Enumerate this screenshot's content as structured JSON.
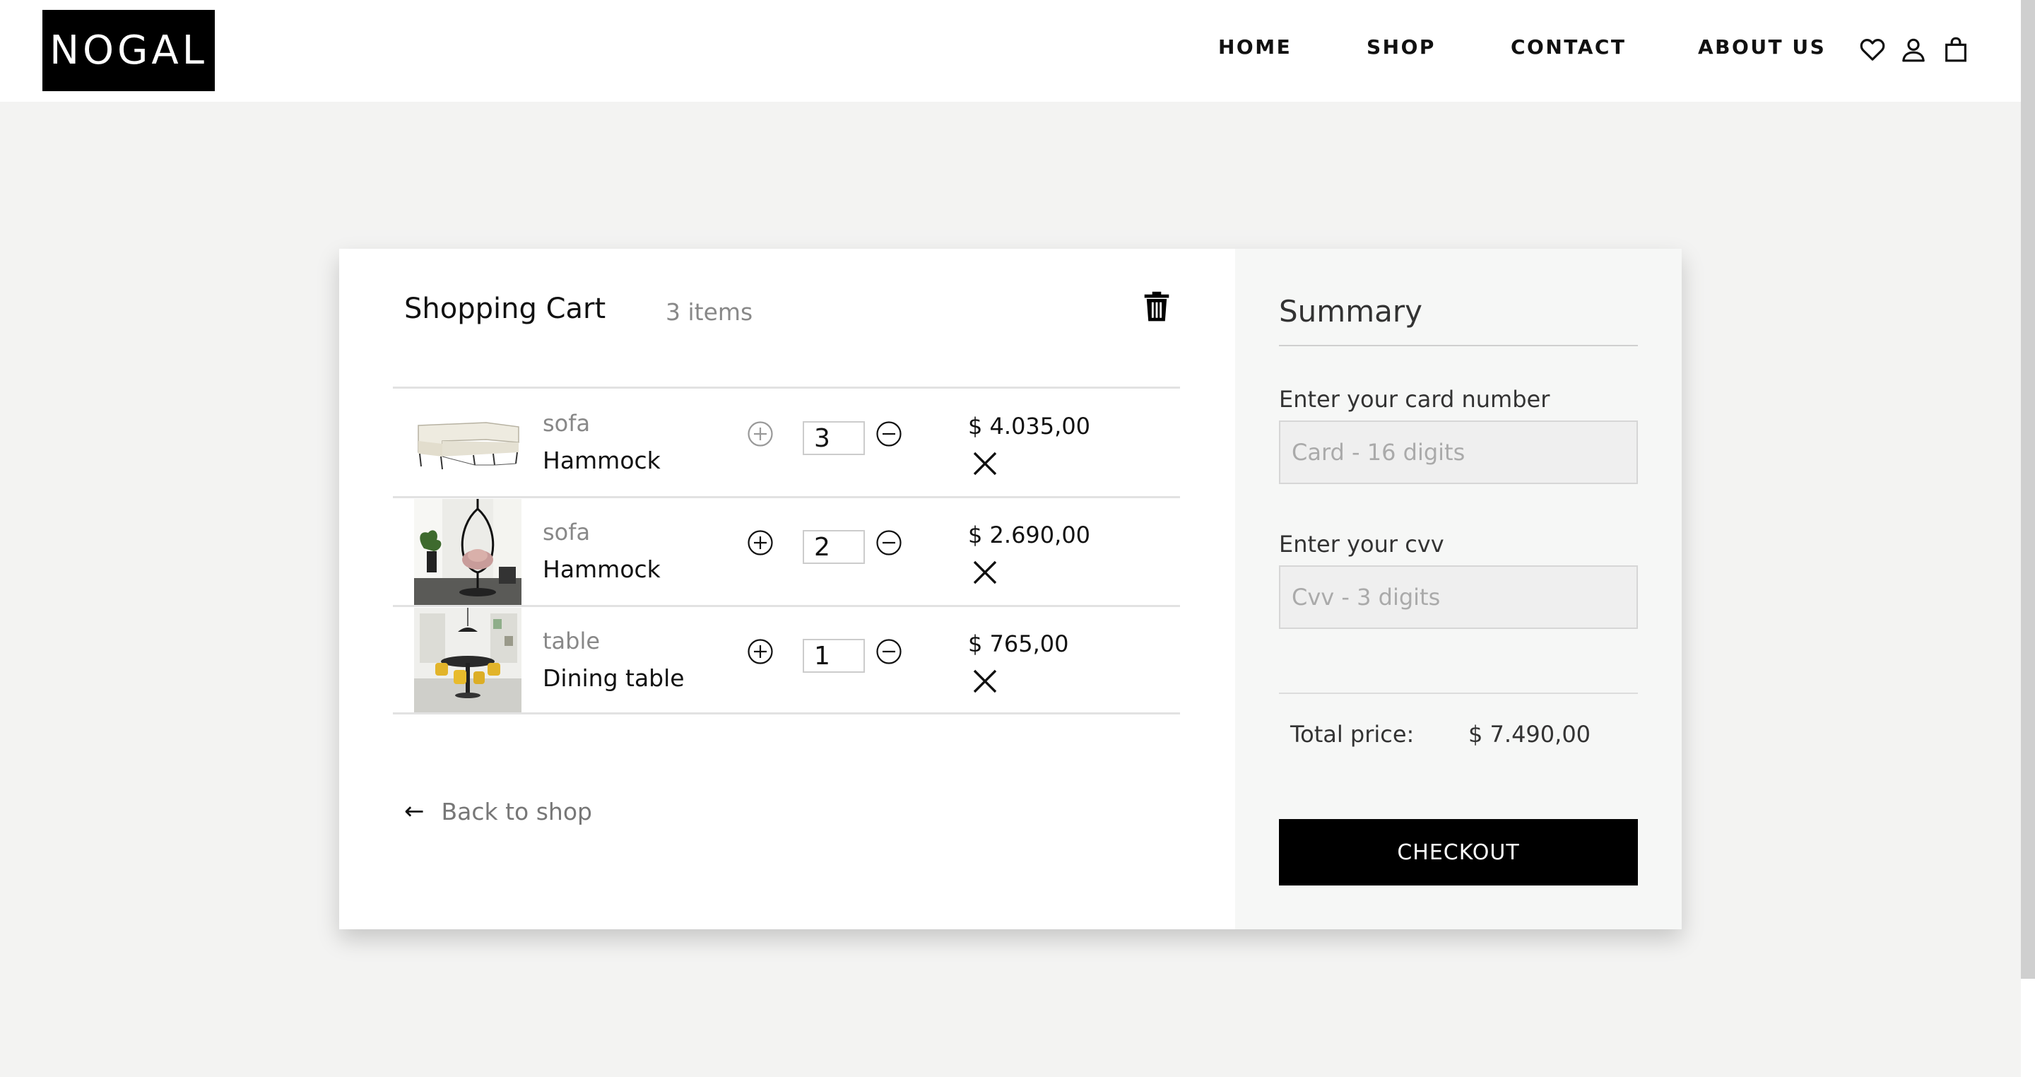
{
  "brand": {
    "logo_text": "NOGAL"
  },
  "nav": [
    {
      "label": "HOME"
    },
    {
      "label": "SHOP"
    },
    {
      "label": "CONTACT"
    },
    {
      "label": "ABOUT US"
    }
  ],
  "header_icons": [
    "heart-icon",
    "user-icon",
    "bag-icon"
  ],
  "cart": {
    "title": "Shopping Cart",
    "count_text": "3 items",
    "items": [
      {
        "category": "sofa",
        "name": "Hammock",
        "quantity": "3",
        "price": "$ 4.035,00"
      },
      {
        "category": "sofa",
        "name": "Hammock",
        "quantity": "2",
        "price": "$ 2.690,00"
      },
      {
        "category": "table",
        "name": "Dining table",
        "quantity": "1",
        "price": "$ 765,00"
      }
    ],
    "back_label": "Back to shop"
  },
  "summary": {
    "title": "Summary",
    "card_label": "Enter your card number",
    "card_placeholder": "Card - 16 digits",
    "cvv_label": "Enter your cvv",
    "cvv_placeholder": "Cvv - 3 digits",
    "total_label": "Total price:",
    "total_value": "$ 7.490,00",
    "checkout_label": "CHECKOUT"
  },
  "colors": {
    "page_bg": "#f3f3f2",
    "brand": "#000000",
    "summary_bg": "#f6f7f6",
    "muted_text": "#888888"
  }
}
